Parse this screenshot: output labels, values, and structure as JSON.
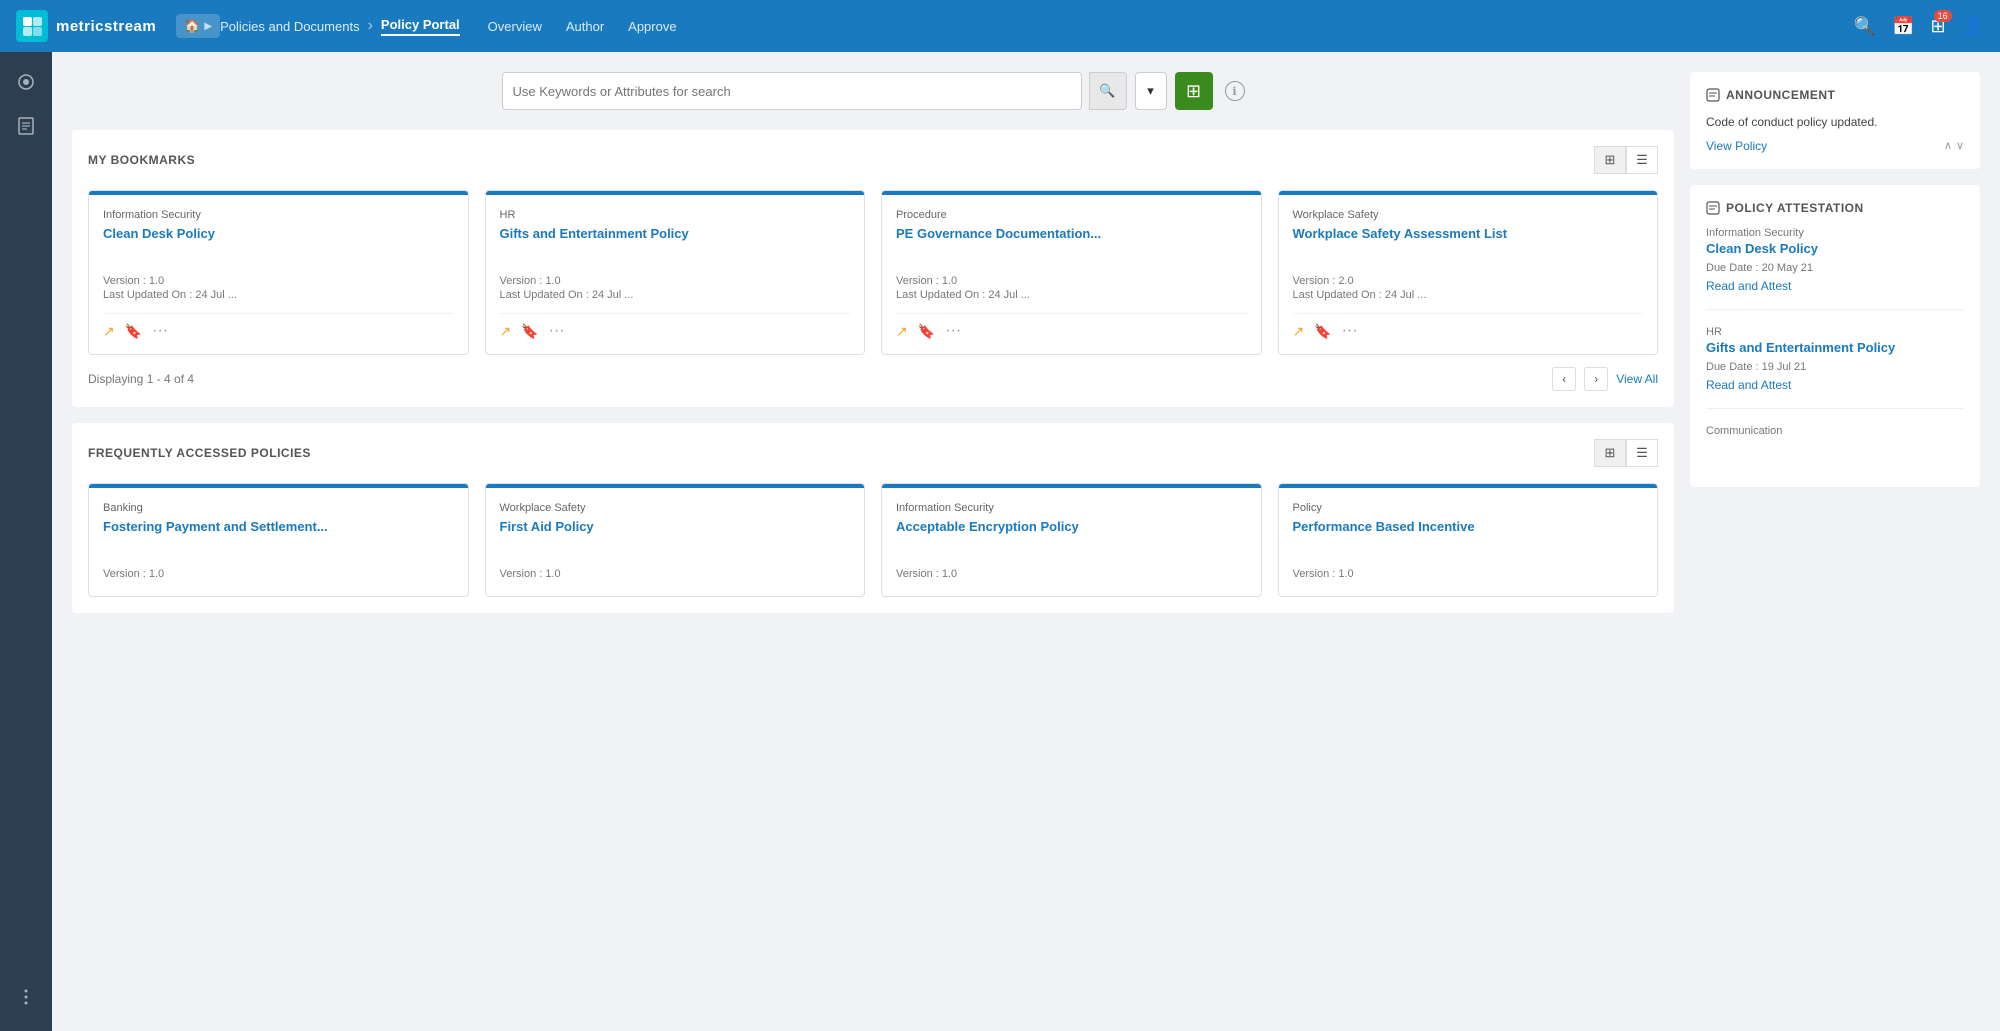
{
  "nav": {
    "logo_letter": "m",
    "logo_full": "metricstream",
    "home_label": "🏠",
    "breadcrumbs": [
      {
        "label": "Policies and Documents",
        "active": false
      },
      {
        "label": "Policy Portal",
        "active": true
      },
      {
        "label": "Overview",
        "active": false
      },
      {
        "label": "Author",
        "active": false
      },
      {
        "label": "Approve",
        "active": false
      }
    ],
    "notification_count": "16"
  },
  "sidebar": {
    "items": [
      {
        "icon": "☰",
        "name": "menu"
      },
      {
        "icon": "📄",
        "name": "documents"
      },
      {
        "icon": "•••",
        "name": "more"
      }
    ]
  },
  "search": {
    "placeholder": "Use Keywords or Attributes for search"
  },
  "bookmarks": {
    "section_title": "MY BOOKMARKS",
    "display_text": "Displaying 1 - 4 of 4",
    "view_all": "View All",
    "cards": [
      {
        "category": "Information Security",
        "title": "Clean Desk Policy",
        "version": "Version : 1.0",
        "updated": "Last Updated On : 24 Jul ..."
      },
      {
        "category": "HR",
        "title": "Gifts and Entertainment Policy",
        "version": "Version : 1.0",
        "updated": "Last Updated On : 24 Jul ..."
      },
      {
        "category": "Procedure",
        "title": "PE Governance Documentation...",
        "version": "Version : 1.0",
        "updated": "Last Updated On : 24 Jul ..."
      },
      {
        "category": "Workplace Safety",
        "title": "Workplace Safety Assessment List",
        "version": "Version : 2.0",
        "updated": "Last Updated On : 24 Jul ..."
      }
    ]
  },
  "frequent": {
    "section_title": "FREQUENTLY ACCESSED POLICIES",
    "cards": [
      {
        "category": "Banking",
        "title": "Fostering Payment and Settlement...",
        "version": "Version : 1.0",
        "updated": ""
      },
      {
        "category": "Workplace Safety",
        "title": "First Aid Policy",
        "version": "Version : 1.0",
        "updated": ""
      },
      {
        "category": "Information Security",
        "title": "Acceptable Encryption Policy",
        "version": "Version : 1.0",
        "updated": ""
      },
      {
        "category": "Policy",
        "title": "Performance Based Incentive",
        "version": "Version : 1.0",
        "updated": ""
      }
    ]
  },
  "announcement": {
    "section_title": "ANNOUNCEMENT",
    "text": "Code of conduct policy updated.",
    "link": "View Policy"
  },
  "attestation": {
    "section_title": "POLICY ATTESTATION",
    "items": [
      {
        "category": "Information Security",
        "title": "Clean Desk Policy",
        "due": "Due Date : 20 May 21",
        "link": "Read and Attest"
      },
      {
        "category": "HR",
        "title": "Gifts and Entertainment Policy",
        "due": "Due Date : 19 Jul 21",
        "link": "Read and Attest"
      },
      {
        "category": "Communication",
        "title": "",
        "due": "",
        "link": ""
      }
    ]
  }
}
